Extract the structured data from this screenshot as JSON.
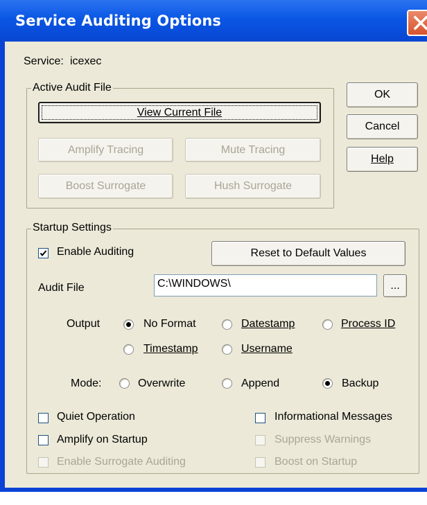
{
  "window": {
    "title": "Service Auditing Options",
    "colors": {
      "titlebar": "#0a56e4",
      "close": "#d6542d",
      "face": "#ece9d8"
    }
  },
  "service": {
    "label": "Service:",
    "name": "icexec"
  },
  "active_audit_file": {
    "title": "Active Audit File",
    "view_current_file": "View Current File",
    "amplify_tracing": "Amplify Tracing",
    "mute_tracing": "Mute Tracing",
    "boost_surrogate": "Boost Surrogate",
    "hush_surrogate": "Hush Surrogate"
  },
  "dialog_buttons": {
    "ok": "OK",
    "cancel": "Cancel",
    "help": "Help"
  },
  "startup_settings": {
    "title": "Startup Settings",
    "enable_auditing": {
      "label": "Enable Auditing",
      "checked": true
    },
    "reset_defaults": "Reset to Default Values",
    "audit_file": {
      "label": "Audit File",
      "value": "C:\\WINDOWS\\",
      "browse": "..."
    },
    "output": {
      "label": "Output",
      "options": [
        "No Format",
        "Datestamp",
        "Process ID",
        "Timestamp",
        "Username"
      ],
      "selected": "No Format"
    },
    "mode": {
      "label": "Mode:",
      "options": [
        "Overwrite",
        "Append",
        "Backup"
      ],
      "selected": "Backup"
    },
    "options": {
      "quiet_operation": "Quiet Operation",
      "informational_messages": "Informational Messages",
      "amplify_on_startup": "Amplify on Startup",
      "suppress_warnings": "Suppress Warnings",
      "enable_surrogate_auditing": "Enable Surrogate Auditing",
      "boost_on_startup": "Boost on Startup"
    }
  }
}
